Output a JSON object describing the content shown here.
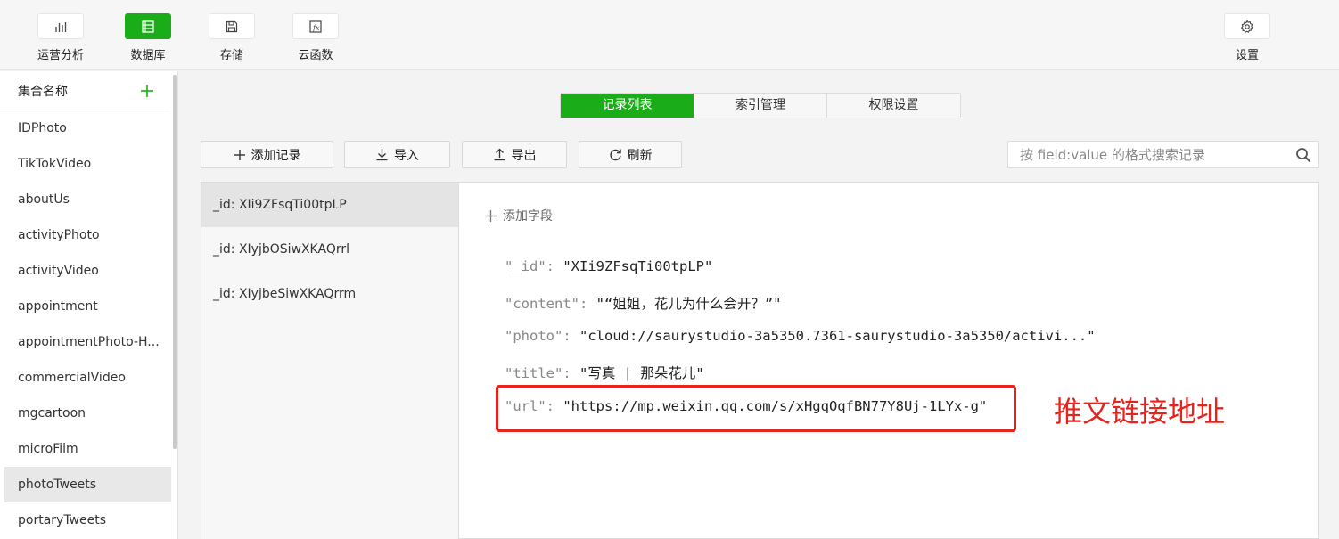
{
  "toolbar": {
    "items": [
      {
        "label": "运营分析",
        "icon": "bar-chart-icon",
        "active": false
      },
      {
        "label": "数据库",
        "icon": "database-icon",
        "active": true
      },
      {
        "label": "存储",
        "icon": "save-icon",
        "active": false
      },
      {
        "label": "云函数",
        "icon": "function-icon",
        "active": false
      }
    ],
    "settings": {
      "label": "设置",
      "icon": "gear-icon"
    }
  },
  "sidebar": {
    "title": "集合名称",
    "add_icon": "plus-icon",
    "items": [
      "IDPhoto",
      "TikTokVideo",
      "aboutUs",
      "activityPhoto",
      "activityVideo",
      "appointment",
      "appointmentPhoto-H...",
      "commercialVideo",
      "mgcartoon",
      "microFilm",
      "photoTweets",
      "portaryTweets"
    ],
    "active_item": "photoTweets"
  },
  "tabs": [
    {
      "label": "记录列表",
      "active": true
    },
    {
      "label": "索引管理",
      "active": false
    },
    {
      "label": "权限设置",
      "active": false
    }
  ],
  "actions": {
    "add_record": "添加记录",
    "import": "导入",
    "export": "导出",
    "refresh": "刷新"
  },
  "search": {
    "placeholder": "按 field:value 的格式搜索记录"
  },
  "records": [
    "_id: XIi9ZFsqTi00tpLP",
    "_id: XIyjbOSiwXKAQrrl",
    "_id: XIyjbeSiwXKAQrrm"
  ],
  "detail": {
    "add_field": "添加字段",
    "fields": [
      {
        "key": "\"_id\"",
        "value": "\"XIi9ZFsqTi00tpLP\""
      },
      {
        "key": "\"content\"",
        "value": "\"“姐姐，花儿为什么会开？”\""
      },
      {
        "key": "\"photo\"",
        "value": "\"cloud://saurystudio-3a5350.7361-saurystudio-3a5350/activi...\""
      },
      {
        "key": "\"title\"",
        "value": "\"写真 | 那朵花儿\""
      },
      {
        "key": "\"url\"",
        "value": "\"https://mp.weixin.qq.com/s/xHgqOqfBN77Y8Uj-1LYx-g\""
      }
    ]
  },
  "annotation": "推文链接地址",
  "colors": {
    "accent": "#1aad19",
    "annotation": "#e8231b"
  }
}
